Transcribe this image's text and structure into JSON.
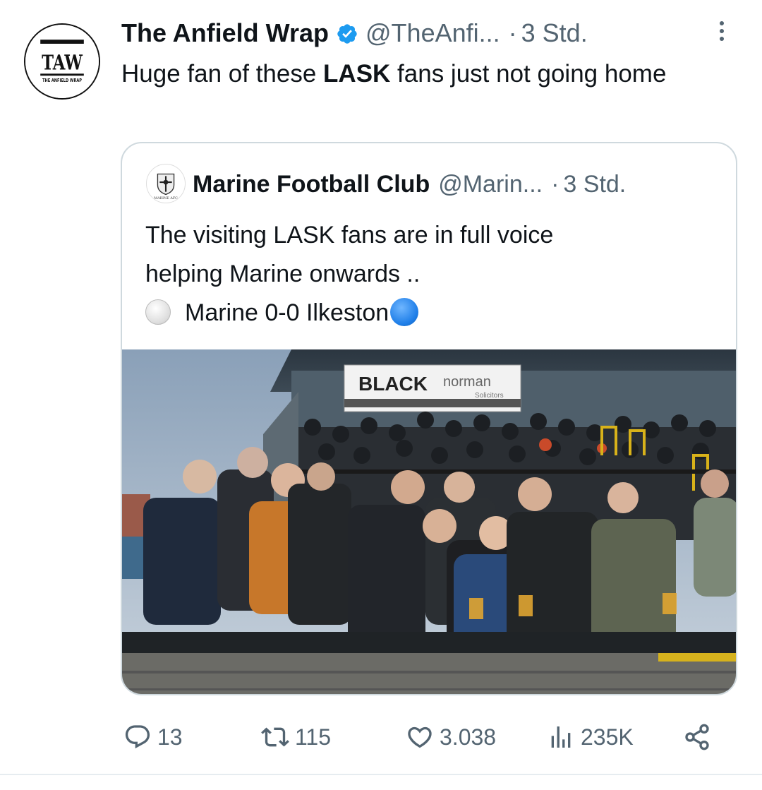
{
  "tweet": {
    "author": {
      "name": "The Anfield Wrap",
      "handle": "@TheAnfi...",
      "verified": true,
      "avatar_text": "TAW",
      "avatar_subtext": "THE ANFIELD WRAP"
    },
    "time": "3 Std.",
    "separator": "·",
    "text_parts": [
      "Huge fan of these ",
      "LASK",
      " fans just not going home"
    ]
  },
  "quoted": {
    "author": {
      "name": "Marine Football Club",
      "handle": "@Marin...",
      "avatar_text": "MARINE AFC"
    },
    "time": "3 Std.",
    "separator": "·",
    "lines": [
      "The visiting LASK fans are in full voice",
      "helping Marine onwards ..",
      "Marine 0-0 Ilkeston"
    ],
    "photo": {
      "sign_main": "BLACK",
      "sign_secondary": "norman",
      "sign_tertiary": "Solicitors"
    }
  },
  "actions": {
    "replies": "13",
    "reposts": "115",
    "likes": "3.038",
    "views": "235K"
  },
  "icons": [
    "verified-badge-icon",
    "more-icon",
    "reply-icon",
    "repost-icon",
    "like-icon",
    "views-icon",
    "share-icon",
    "white-circle-emoji",
    "blue-circle-emoji"
  ],
  "colors": {
    "text": "#0f1419",
    "secondary": "#536471",
    "verified": "#1d9bf0",
    "border": "#cfd9de"
  }
}
